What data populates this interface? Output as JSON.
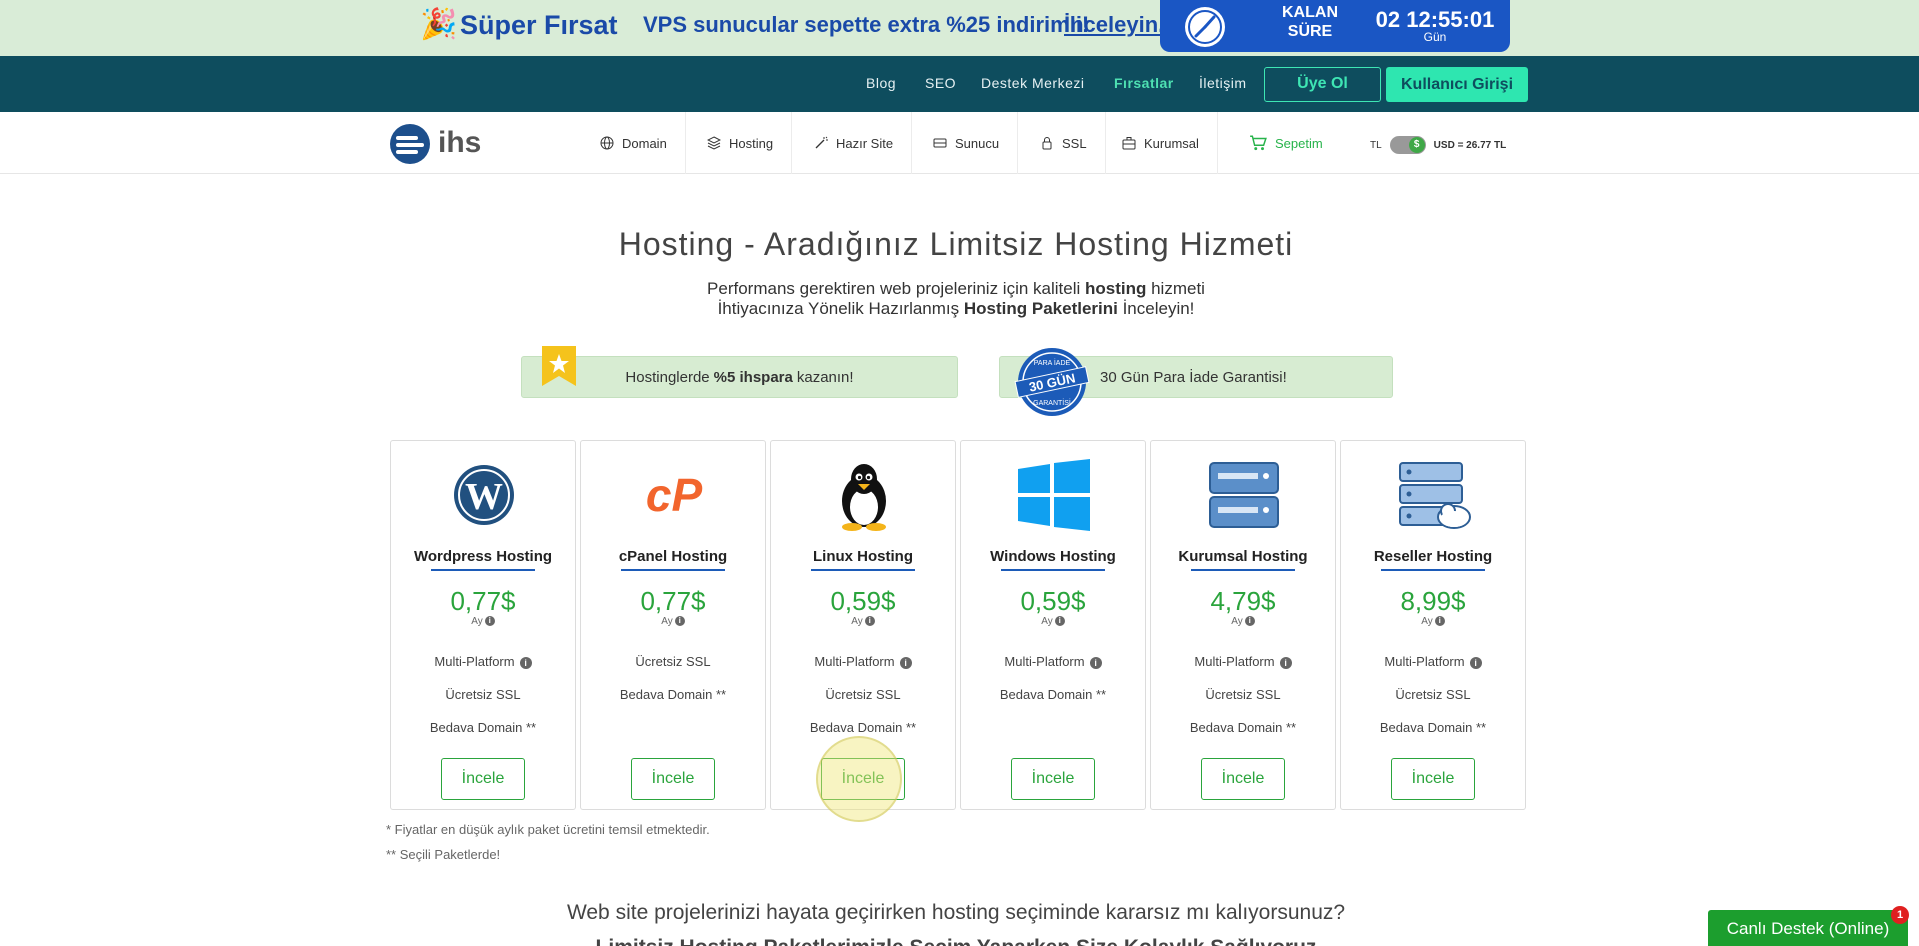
{
  "promo": {
    "party_icon": "party-popper-icon",
    "title": "Süper Fırsat",
    "text": "VPS sunucular sepette extra %25 indirimli!",
    "link": "İnceleyin.",
    "timer_label_1": "KALAN",
    "timer_label_2": "SÜRE",
    "countdown": "02 12:55:01",
    "countdown_unit": "Gün"
  },
  "topnav": {
    "items": [
      "Blog",
      "SEO",
      "Destek Merkezi",
      "Fırsatlar",
      "İletişim"
    ],
    "register": "Üye Ol",
    "login": "Kullanıcı Girişi"
  },
  "mainnav": {
    "logo_text": "ihs",
    "items": [
      {
        "label": "Domain",
        "icon": "globe-icon"
      },
      {
        "label": "Hosting",
        "icon": "layers-icon"
      },
      {
        "label": "Hazır Site",
        "icon": "wand-icon"
      },
      {
        "label": "Sunucu",
        "icon": "server-icon"
      },
      {
        "label": "SSL",
        "icon": "lock-icon"
      },
      {
        "label": "Kurumsal",
        "icon": "briefcase-icon"
      }
    ],
    "cart": "Sepetim",
    "currency_left": "TL",
    "currency_symbol": "$",
    "currency_rate": "USD = 26.77 TL"
  },
  "hero": {
    "title": "Hosting  - Aradığınız Limitsiz Hosting Hizmeti",
    "sub1_pre": "Performans gerektiren web projeleriniz için kaliteli ",
    "sub1_bold": "hosting",
    "sub1_post": " hizmeti",
    "sub2_pre": "İhtiyacınıza Yönelik Hazırlanmış ",
    "sub2_bold": "Hosting Paketlerini",
    "sub2_post": " İnceleyin!"
  },
  "badges": {
    "left_pre": "Hostinglerde ",
    "left_bold": "%5 ihspara",
    "left_post": " kazanın!",
    "right_text": "30 Gün Para İade Garantisi!",
    "seal_top": "PARA İADE",
    "seal_mid": "30 GÜN",
    "seal_bottom": "GARANTİSİ"
  },
  "cards": [
    {
      "title": "Wordpress Hosting",
      "price": "0,77$",
      "period": "Ay",
      "icon": "wordpress-icon",
      "features": [
        {
          "text": "Multi-Platform",
          "info": true
        },
        {
          "text": "Ücretsiz SSL",
          "info": false
        },
        {
          "text": "Bedava Domain **",
          "info": false
        }
      ],
      "button": "İncele"
    },
    {
      "title": "cPanel Hosting",
      "price": "0,77$",
      "period": "Ay",
      "icon": "cpanel-icon",
      "features": [
        {
          "text": "Ücretsiz SSL",
          "info": false
        },
        {
          "text": "Bedava Domain **",
          "info": false
        }
      ],
      "button": "İncele"
    },
    {
      "title": "Linux Hosting",
      "price": "0,59$",
      "period": "Ay",
      "icon": "linux-tux-icon",
      "features": [
        {
          "text": "Multi-Platform",
          "info": true
        },
        {
          "text": "Ücretsiz SSL",
          "info": false
        },
        {
          "text": "Bedava Domain **",
          "info": false
        }
      ],
      "button": "İncele"
    },
    {
      "title": "Windows Hosting",
      "price": "0,59$",
      "period": "Ay",
      "icon": "windows-icon",
      "features": [
        {
          "text": "Multi-Platform",
          "info": true
        },
        {
          "text": "Bedava Domain **",
          "info": false
        }
      ],
      "button": "İncele"
    },
    {
      "title": "Kurumsal Hosting",
      "price": "4,79$",
      "period": "Ay",
      "icon": "server-rack-icon",
      "features": [
        {
          "text": "Multi-Platform",
          "info": true
        },
        {
          "text": "Ücretsiz SSL",
          "info": false
        },
        {
          "text": "Bedava Domain **",
          "info": false
        }
      ],
      "button": "İncele"
    },
    {
      "title": "Reseller Hosting",
      "price": "8,99$",
      "period": "Ay",
      "icon": "reseller-cloud-icon",
      "features": [
        {
          "text": "Multi-Platform",
          "info": true
        },
        {
          "text": "Ücretsiz SSL",
          "info": false
        },
        {
          "text": "Bedava Domain **",
          "info": false
        }
      ],
      "button": "İncele"
    }
  ],
  "footnotes": [
    "* Fiyatlar en düşük aylık paket ücretini temsil etmektedir.",
    "** Seçili Paketlerde!"
  ],
  "bottom": {
    "title": "Web site projelerinizi hayata geçirirken hosting seçiminde kararsız mı kalıyorsunuz?",
    "sub": "Limitsiz Hosting Paketlerimizle Seçim Yaparken Size Kolaylık Sağlıyoruz"
  },
  "chat": {
    "label": "Canlı Destek (Online)",
    "badge": "1"
  },
  "colors": {
    "primary_green": "#2aa43c",
    "nav_teal": "#0e4d5e",
    "accent_mint": "#2ee6b0",
    "promo_blue": "#1a4aa8"
  }
}
